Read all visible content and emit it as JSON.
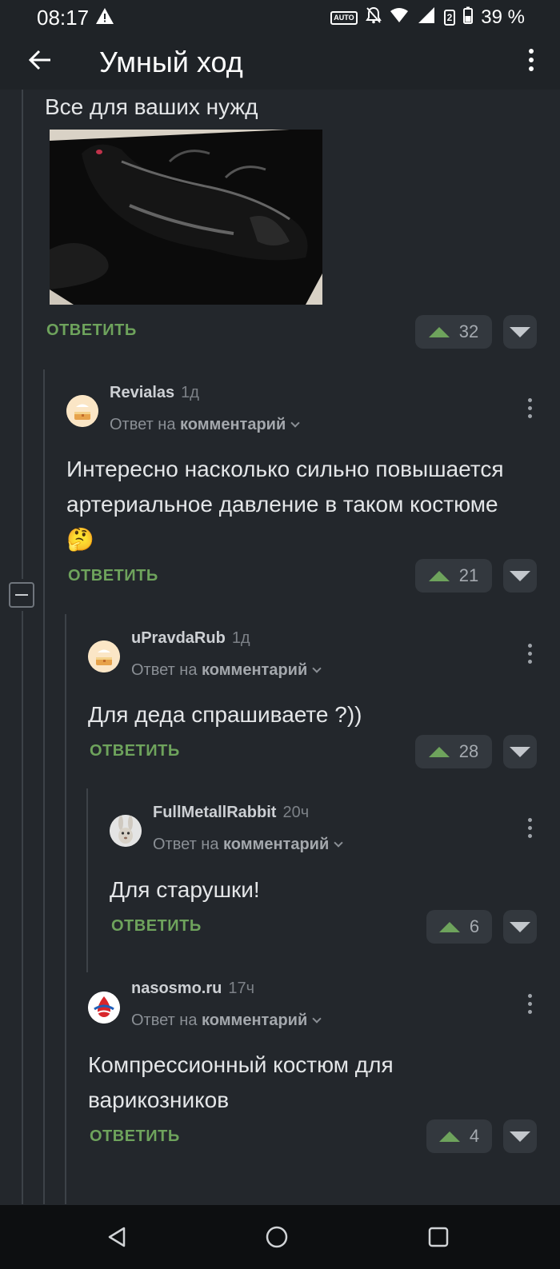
{
  "status_bar": {
    "time": "08:17",
    "network_badge": "2",
    "battery": "39 %"
  },
  "toolbar": {
    "title": "Умный ход"
  },
  "post": {
    "text": "Все для ваших нужд",
    "reply_label": "ОТВЕТИТЬ",
    "rating": "32",
    "image": {
      "icon": "image-photo",
      "colors": {
        "rim": "#d9d2c6",
        "dark": "#0a0a0a",
        "gloss": "#9a9a9a"
      }
    }
  },
  "comments": [
    {
      "author": "Revialas",
      "time": "1д",
      "reply_prefix": "Ответ на",
      "reply_target": "комментарий",
      "text": "Интересно насколько сильно повышается артериальное давление в таком костюме 🤔",
      "reply_label": "ОТВЕТИТЬ",
      "rating": "21",
      "avatar": "cake-avatar"
    },
    {
      "author": "uPravdaRub",
      "time": "1д",
      "reply_prefix": "Ответ на",
      "reply_target": "комментарий",
      "text": "Для деда спрашиваете ?))",
      "reply_label": "ОТВЕТИТЬ",
      "rating": "28",
      "avatar": "cake-avatar"
    },
    {
      "author": "FullMetallRabbit",
      "time": "20ч",
      "reply_prefix": "Ответ на",
      "reply_target": "комментарий",
      "text": "Для старушки!",
      "reply_label": "ОТВЕТИТЬ",
      "rating": "6",
      "avatar": "rabbit-avatar"
    },
    {
      "author": "nasosmo.ru",
      "time": "17ч",
      "reply_prefix": "Ответ на",
      "reply_target": "комментарий",
      "text": "Компрессионный костюм для варикозников",
      "reply_label": "ОТВЕТИТЬ",
      "rating": "4",
      "avatar": "drop-logo-avatar"
    }
  ],
  "colors": {
    "background": "#23272c",
    "accent_green": "#6ea35c",
    "vote_bg": "#33383e"
  }
}
